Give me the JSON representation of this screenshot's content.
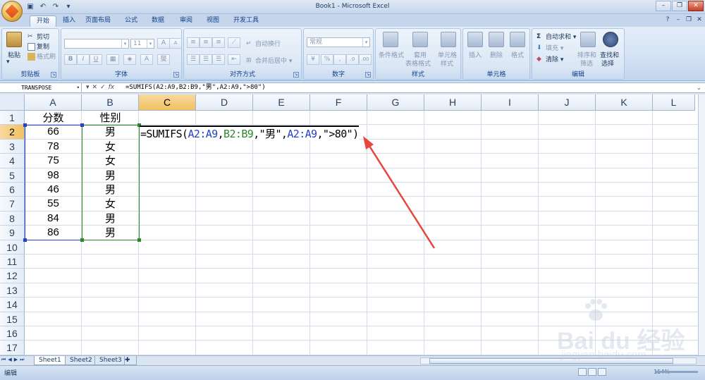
{
  "window": {
    "title": "Book1 - Microsoft Excel"
  },
  "tabs": [
    "开始",
    "插入",
    "页面布局",
    "公式",
    "数据",
    "审阅",
    "视图",
    "开发工具"
  ],
  "ribbon": {
    "clipboard": {
      "label": "剪贴板",
      "paste": "粘贴",
      "cut": "剪切",
      "copy": "复制",
      "format_painter": "格式刷"
    },
    "font": {
      "label": "字体",
      "size": "11",
      "bold": "B",
      "italic": "I",
      "underline": "U"
    },
    "alignment": {
      "label": "对齐方式",
      "wrap_text": "自动换行",
      "merge_center": "合并后居中"
    },
    "number": {
      "label": "数字",
      "format": "常规"
    },
    "styles": {
      "label": "样式",
      "conditional": "条件格式",
      "table_format_1": "套用",
      "table_format_2": "表格格式",
      "cell_style_1": "单元格",
      "cell_style_2": "样式"
    },
    "cells": {
      "label": "单元格",
      "insert": "插入",
      "delete": "删除",
      "format": "格式"
    },
    "editing": {
      "label": "编辑",
      "autosum": "自动求和",
      "fill": "填充",
      "clear": "清除",
      "sort_1": "排序和",
      "sort_2": "筛选",
      "find_1": "查找和",
      "find_2": "选择"
    }
  },
  "formula_bar": {
    "name_box": "TRANSPOSE",
    "fx": "fx",
    "formula": "=SUMIFS(A2:A9,B2:B9,\"男\",A2:A9,\">80\")"
  },
  "grid": {
    "columns": [
      "A",
      "B",
      "C",
      "D",
      "E",
      "F",
      "G",
      "H",
      "I",
      "J",
      "K",
      "L"
    ],
    "rows": [
      "1",
      "2",
      "3",
      "4",
      "5",
      "6",
      "7",
      "8",
      "9",
      "10",
      "11",
      "12",
      "13",
      "14",
      "15",
      "16",
      "17"
    ],
    "header_a": "分数",
    "header_b": "性别",
    "scores": [
      "66",
      "78",
      "75",
      "98",
      "46",
      "55",
      "84",
      "86"
    ],
    "genders": [
      "男",
      "女",
      "女",
      "男",
      "男",
      "女",
      "男",
      "男"
    ],
    "edit": {
      "prefix": "=SUMIFS(",
      "ref1": "A2:A9",
      "sep1": ",",
      "ref2": "B2:B9",
      "mid": ",\"男\",",
      "ref3": "A2:A9",
      "suffix": ",\">80\")"
    }
  },
  "sheets": [
    "Sheet1",
    "Sheet2",
    "Sheet3"
  ],
  "status": {
    "mode": "编辑",
    "zoom": "154%"
  },
  "watermark": {
    "text": "Bai du 经验",
    "sub": "jingyan.baidu.com"
  },
  "colors": {
    "ref_blue": "#2540c9",
    "ref_green": "#2a8a2a",
    "arrow_red": "#e8453c",
    "selected_header": "#f1c15f"
  }
}
